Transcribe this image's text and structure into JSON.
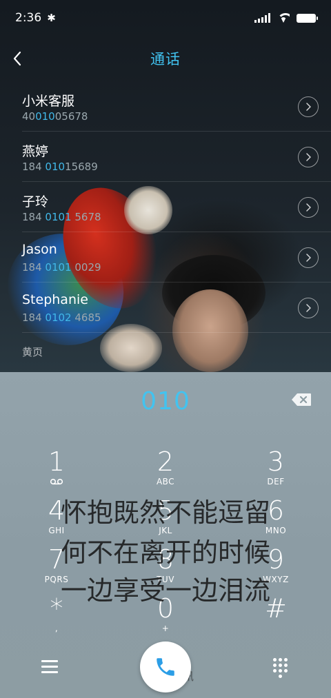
{
  "status_bar": {
    "time": "2:36",
    "bluetooth": "bluetooth-icon"
  },
  "header": {
    "title": "通话",
    "back_icon": "chevron-left-icon"
  },
  "contacts": [
    {
      "name": "小米客服",
      "number_pre": "40",
      "number_hl": "010",
      "number_post": "05678"
    },
    {
      "name": "燕婷",
      "number_pre": "184 ",
      "number_hl": "010",
      "number_post": "15689"
    },
    {
      "name": "子玲",
      "number_pre": "184 ",
      "number_hl": "0101",
      "number_post": " 5678"
    },
    {
      "name": "Jason",
      "number_pre": "184 ",
      "number_hl": "0101",
      "number_post": " 0029"
    },
    {
      "name": "Stephanie",
      "number_pre": "184 ",
      "number_hl": "0102",
      "number_post": " 4685"
    }
  ],
  "yellow_pages": "黄页",
  "dialer": {
    "number": "010",
    "keys": [
      {
        "digit": "1",
        "letters": ""
      },
      {
        "digit": "2",
        "letters": "ABC"
      },
      {
        "digit": "3",
        "letters": "DEF"
      },
      {
        "digit": "4",
        "letters": "GHI"
      },
      {
        "digit": "5",
        "letters": "JKL"
      },
      {
        "digit": "6",
        "letters": "MNO"
      },
      {
        "digit": "7",
        "letters": "PQRS"
      },
      {
        "digit": "8",
        "letters": "TUV"
      },
      {
        "digit": "9",
        "letters": "WXYZ"
      },
      {
        "digit": "*",
        "letters": ","
      },
      {
        "digit": "0",
        "letters": "+"
      },
      {
        "digit": "#",
        "letters": ""
      }
    ]
  },
  "wallpaper_text": {
    "line1": "怀抱既然不能逗留",
    "line2": "何不在离开的时候",
    "line3": "一边享受一边泪流",
    "signature": "讯"
  },
  "colors": {
    "accent": "#41c3f0",
    "dialer_bg": "#8f9fa6"
  }
}
